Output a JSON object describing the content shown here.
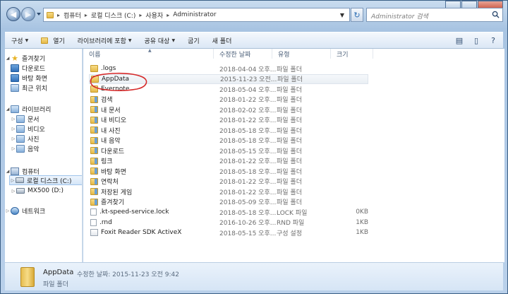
{
  "address": {
    "segments": [
      "컴퓨터",
      "로컬 디스크 (C:)",
      "사용자",
      "Administrator"
    ]
  },
  "search": {
    "placeholder": "Administrator 검색"
  },
  "command_bar": [
    "구성",
    "열기",
    "라이브러리에 포함",
    "공유 대상",
    "굽기",
    "새 폴더"
  ],
  "nav": {
    "favorites": "즐겨찾기",
    "fav_items": [
      "다운로드",
      "바탕 화면",
      "최근 위치"
    ],
    "libraries": "라이브러리",
    "lib_items": [
      "문서",
      "비디오",
      "사진",
      "음악"
    ],
    "computer": "컴퓨터",
    "comp_items": [
      "로컬 디스크 (C:)",
      "MX500 (D:)"
    ],
    "network": "네트워크"
  },
  "columns": {
    "name": "이름",
    "date": "수정한 날짜",
    "type": "유형",
    "size": "크기"
  },
  "files": [
    {
      "name": ".logs",
      "date": "2018-04-04 오후...",
      "type": "파일 폴더",
      "size": "",
      "icon": "folder"
    },
    {
      "name": "AppData",
      "date": "2015-11-23 오전...",
      "type": "파일 폴더",
      "size": "",
      "icon": "folder"
    },
    {
      "name": "Evernote",
      "date": "2018-05-04 오후...",
      "type": "파일 폴더",
      "size": "",
      "icon": "folder"
    },
    {
      "name": "검색",
      "date": "2018-01-22 오후...",
      "type": "파일 폴더",
      "size": "",
      "icon": "special"
    },
    {
      "name": "내 문서",
      "date": "2018-02-02 오후...",
      "type": "파일 폴더",
      "size": "",
      "icon": "special"
    },
    {
      "name": "내 비디오",
      "date": "2018-01-22 오후...",
      "type": "파일 폴더",
      "size": "",
      "icon": "special"
    },
    {
      "name": "내 사진",
      "date": "2018-05-18 오후...",
      "type": "파일 폴더",
      "size": "",
      "icon": "special"
    },
    {
      "name": "내 음악",
      "date": "2018-05-18 오후...",
      "type": "파일 폴더",
      "size": "",
      "icon": "special"
    },
    {
      "name": "다운로드",
      "date": "2018-05-15 오후...",
      "type": "파일 폴더",
      "size": "",
      "icon": "special"
    },
    {
      "name": "링크",
      "date": "2018-01-22 오후...",
      "type": "파일 폴더",
      "size": "",
      "icon": "special"
    },
    {
      "name": "바탕 화면",
      "date": "2018-05-18 오후...",
      "type": "파일 폴더",
      "size": "",
      "icon": "special"
    },
    {
      "name": "연락처",
      "date": "2018-01-22 오후...",
      "type": "파일 폴더",
      "size": "",
      "icon": "special"
    },
    {
      "name": "저장된 게임",
      "date": "2018-01-22 오후...",
      "type": "파일 폴더",
      "size": "",
      "icon": "special"
    },
    {
      "name": "즐겨찾기",
      "date": "2018-05-09 오후...",
      "type": "파일 폴더",
      "size": "",
      "icon": "special"
    },
    {
      "name": ".kt-speed-service.lock",
      "date": "2018-05-18 오후...",
      "type": "LOCK 파일",
      "size": "0KB",
      "icon": "file"
    },
    {
      "name": ".rnd",
      "date": "2016-10-26 오후...",
      "type": "RND 파일",
      "size": "1KB",
      "icon": "file"
    },
    {
      "name": "Foxit Reader SDK ActiveX",
      "date": "2018-05-15 오후...",
      "type": "구성 설정",
      "size": "1KB",
      "icon": "app"
    }
  ],
  "details": {
    "name": "AppData",
    "modified": "수정한 날짜: 2015-11-23 오전 9:42",
    "type": "파일 폴더"
  }
}
